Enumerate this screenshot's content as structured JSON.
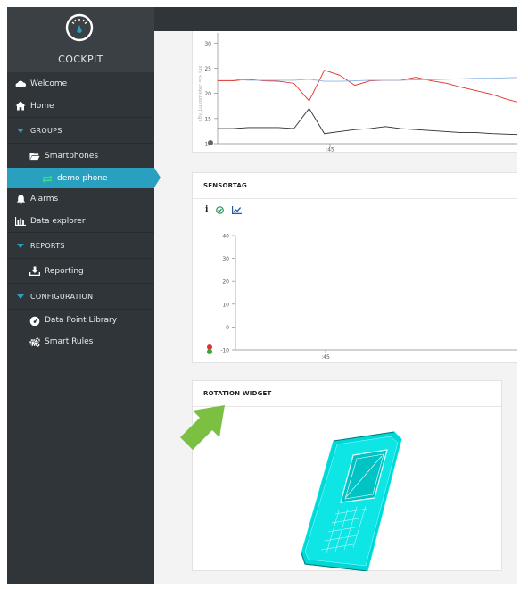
{
  "sidebar": {
    "brand": "COCKPIT",
    "nav": {
      "welcome": "Welcome",
      "home": "Home",
      "groups": "GROUPS",
      "smartphones": "Smartphones",
      "demo_phone": "demo phone",
      "alarms": "Alarms",
      "data_explorer": "Data explorer",
      "reports": "REPORTS",
      "reporting": "Reporting",
      "configuration": "CONFIGURATION",
      "data_point_library": "Data Point Library",
      "smart_rules": "Smart Rules"
    }
  },
  "colors": {
    "sidebar": "#2f3539",
    "active": "#2aa0c0",
    "model": "#00e0e0",
    "arrow": "#7bc043"
  },
  "top_chart": {
    "y_axis_label": "c8y_Luxometer => lux",
    "chart_data": {
      "type": "line",
      "x": [
        0,
        1,
        2,
        3,
        4,
        5,
        6,
        7,
        8,
        9,
        10,
        11,
        12,
        13,
        14,
        15,
        16,
        17,
        18,
        19,
        20
      ],
      "x_tick_labels": [
        ":45"
      ],
      "ylim": [
        10,
        32
      ],
      "y_ticks": [
        10,
        15,
        20,
        25,
        30
      ],
      "series": [
        {
          "color": "#e0302b",
          "values": [
            22.5,
            22.5,
            22.8,
            22.5,
            22.4,
            22.0,
            18.5,
            24.6,
            23.6,
            21.6,
            22.5,
            22.6,
            22.6,
            23.2,
            22.5,
            22.0,
            21.2,
            20.5,
            19.8,
            18.8,
            18.0
          ]
        },
        {
          "color": "#8db4e2",
          "values": [
            22.8,
            22.8,
            22.6,
            22.6,
            22.6,
            22.6,
            22.8,
            22.4,
            22.4,
            22.5,
            22.6,
            22.6,
            22.6,
            22.7,
            22.7,
            22.8,
            22.9,
            23.0,
            23.0,
            23.1,
            23.2
          ]
        },
        {
          "color": "#2b2b2b",
          "values": [
            13.0,
            13.0,
            13.2,
            13.2,
            13.2,
            13.0,
            17.0,
            12.0,
            12.4,
            12.8,
            13.0,
            13.4,
            13.0,
            12.8,
            12.6,
            12.4,
            12.2,
            12.2,
            12.0,
            11.9,
            11.8
          ]
        }
      ]
    }
  },
  "sensortag": {
    "title": "SENSORTAG",
    "tools": [
      "info-icon",
      "check-circle-icon",
      "line-chart-icon"
    ],
    "chart_data": {
      "type": "line",
      "x_tick_labels": [
        ":45"
      ],
      "ylim": [
        -10,
        40
      ],
      "y_ticks": [
        -10,
        0,
        10,
        20,
        30,
        40
      ],
      "series": []
    }
  },
  "rotation": {
    "title": "ROTATION WIDGET"
  }
}
